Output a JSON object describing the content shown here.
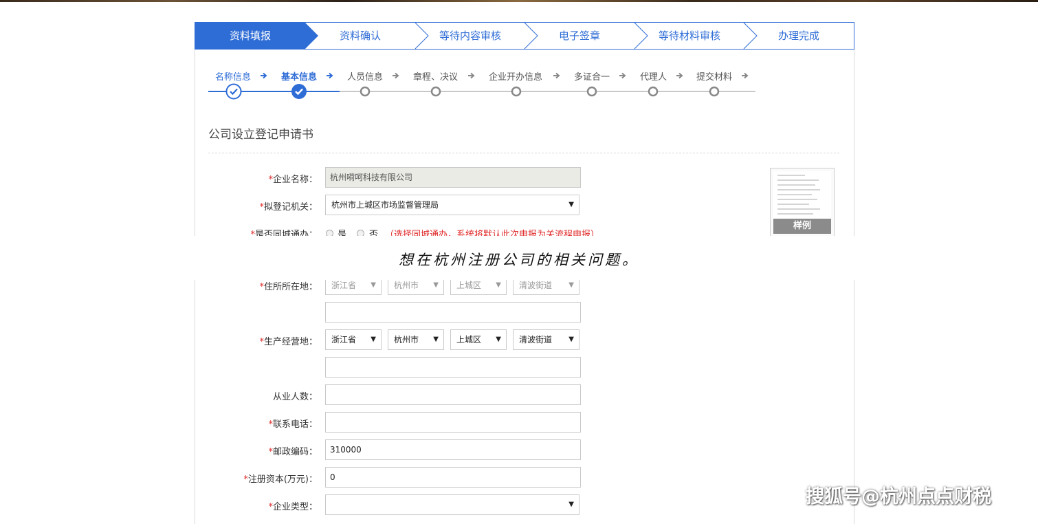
{
  "steps": [
    {
      "label": "资料填报",
      "active": true
    },
    {
      "label": "资料确认",
      "active": false
    },
    {
      "label": "等待内容审核",
      "active": false
    },
    {
      "label": "电子签章",
      "active": false
    },
    {
      "label": "等待材料审核",
      "active": false
    },
    {
      "label": "办理完成",
      "active": false
    }
  ],
  "substeps": [
    {
      "label": "名称信息",
      "state": "done"
    },
    {
      "label": "基本信息",
      "state": "current"
    },
    {
      "label": "人员信息",
      "state": "todo"
    },
    {
      "label": "章程、决议",
      "state": "todo"
    },
    {
      "label": "企业开办信息",
      "state": "todo"
    },
    {
      "label": "多证合一",
      "state": "todo"
    },
    {
      "label": "代理人",
      "state": "todo"
    },
    {
      "label": "提交材料",
      "state": "todo"
    }
  ],
  "page_title": "公司设立登记申请书",
  "form": {
    "company_name": {
      "label": "企业名称：",
      "value": "杭州嗬呵科技有限公司",
      "required": true
    },
    "registration_authority": {
      "label": "拟登记机关：",
      "value": "杭州市上城区市场监督管理局",
      "required": true
    },
    "same_city": {
      "label": "是否同城通办：",
      "opt_yes": "是",
      "opt_no": "否",
      "hint": "（选择同城通办，系统将默认此次申报为关流程申报）",
      "required": true
    },
    "domicile": {
      "label": "住所所在地：",
      "province": "浙江省",
      "city": "杭州市",
      "district": "上城区",
      "street": "清波街道",
      "detail": "",
      "required": true
    },
    "business_place": {
      "label": "生产经营地：",
      "province": "浙江省",
      "city": "杭州市",
      "district": "上城区",
      "street": "清波街道",
      "detail": "",
      "required": true
    },
    "employees": {
      "label": "从业人数：",
      "value": "",
      "required": false
    },
    "phone": {
      "label": "联系电话：",
      "value": "",
      "required": true
    },
    "postal_code": {
      "label": "邮政编码：",
      "value": "310000",
      "required": true
    },
    "capital": {
      "label": "注册资本(万元)：",
      "value": "0",
      "required": true
    },
    "company_type": {
      "label": "企业类型：",
      "value": "",
      "required": true
    }
  },
  "required_mark": "*",
  "sample_label": "样例",
  "overlay_caption": "想在杭州注册公司的相关问题。",
  "watermark": "搜狐号@杭州点点财税",
  "colors": {
    "accent": "#2f6dd6",
    "required": "#e02b2b"
  }
}
